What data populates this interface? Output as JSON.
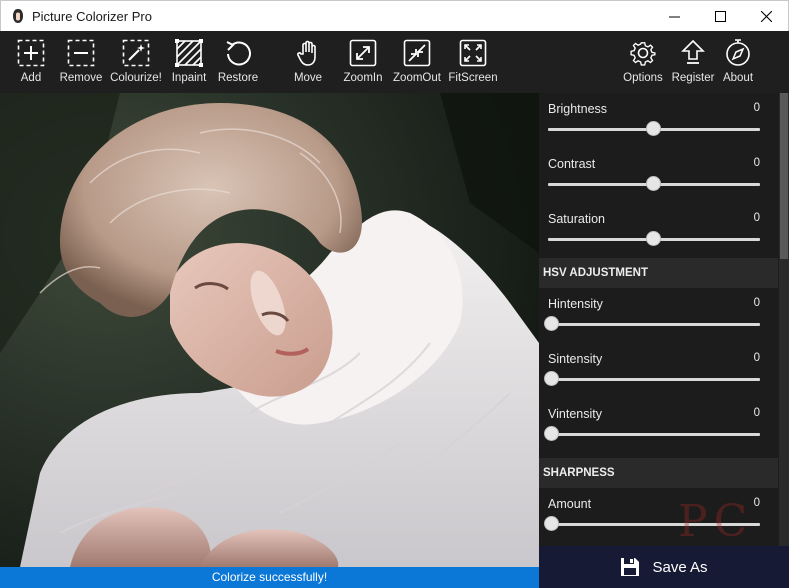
{
  "window": {
    "title": "Picture Colorizer Pro",
    "controls": [
      "minimize-icon",
      "maximize-icon",
      "close-icon"
    ]
  },
  "toolbar": {
    "left_tools": [
      {
        "label": "Add",
        "icon": "add-icon"
      },
      {
        "label": "Remove",
        "icon": "remove-icon"
      },
      {
        "label": "Colourize!",
        "icon": "magic-wand-icon"
      },
      {
        "label": "Inpaint",
        "icon": "inpaint-icon"
      },
      {
        "label": "Restore",
        "icon": "restore-icon"
      }
    ],
    "mid_tools": [
      {
        "label": "Move",
        "icon": "hand-icon"
      },
      {
        "label": "ZoomIn",
        "icon": "zoom-in-icon"
      },
      {
        "label": "ZoomOut",
        "icon": "zoom-out-icon"
      },
      {
        "label": "FitScreen",
        "icon": "fit-screen-icon"
      }
    ],
    "right_tools": [
      {
        "label": "Options",
        "icon": "gear-icon"
      },
      {
        "label": "Register",
        "icon": "upload-arrow-icon"
      },
      {
        "label": "About",
        "icon": "compass-icon"
      }
    ]
  },
  "panel": {
    "basic": [
      {
        "label": "Brightness",
        "value": "0",
        "position": 0.5
      },
      {
        "label": "Contrast",
        "value": "0",
        "position": 0.5
      },
      {
        "label": "Saturation",
        "value": "0",
        "position": 0.5
      }
    ],
    "hsv": {
      "title": "HSV ADJUSTMENT",
      "sliders": [
        {
          "label": "Hintensity",
          "value": "0",
          "position": 0.0
        },
        {
          "label": "Sintensity",
          "value": "0",
          "position": 0.0
        },
        {
          "label": "Vintensity",
          "value": "0",
          "position": 0.0
        }
      ]
    },
    "sharpness": {
      "title": "SHARPNESS",
      "sliders": [
        {
          "label": "Amount",
          "value": "0",
          "position": 0.0
        }
      ]
    }
  },
  "save": {
    "label": "Save As",
    "icon": "floppy-disk-icon"
  },
  "status": {
    "text": "Colorize successfully!"
  },
  "colors": {
    "toolbar": "#1f1f1f",
    "panel": "#1c1c1c",
    "status": "#0b78d7",
    "save": "#171a34"
  }
}
